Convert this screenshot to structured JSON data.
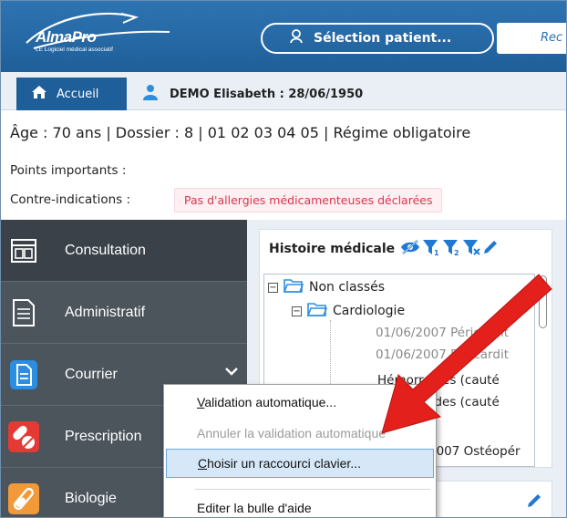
{
  "header": {
    "logo_text": "AlmaPro",
    "logo_subtitle": "LE Logiciel médical associatif",
    "select_patient_label": "Sélection patient...",
    "search_placeholder": "Rec"
  },
  "tabs": {
    "home_label": "Accueil",
    "patient_label": "DEMO Elisabeth : 28/06/1950"
  },
  "patient": {
    "info_line": "Âge : 70 ans | Dossier : 8 | 01 02 03 04 05 | Régime obligatoire",
    "points_label": "Points importants :",
    "contre_label": "Contre-indications :",
    "allergy_badge": "Pas d'allergies médicamenteuses déclarées"
  },
  "nav": {
    "items": [
      {
        "label": "Consultation"
      },
      {
        "label": "Administratif"
      },
      {
        "label": "Courrier"
      },
      {
        "label": "Prescription"
      },
      {
        "label": "Biologie"
      }
    ]
  },
  "history": {
    "title": "Histoire médicale",
    "tree": {
      "root": "Non classés",
      "category": "Cardiologie",
      "leaf1": "01/06/2007 Péricardit",
      "leaf2": "01/06/2007 Péricardit",
      "leaf3": "Hémorroïdes (cauté",
      "leaf4": "Hémorroïdes (cauté",
      "leaf5": "2007 Ostéopér"
    }
  },
  "context_menu": {
    "item1_ul": "V",
    "item1_rest": "alidation automatique...",
    "item2": "Annuler la validation automatique",
    "item3_ul": "C",
    "item3_rest": "hoisir un raccourci clavier...",
    "item4": "Editer la bulle d'aide"
  },
  "colors": {
    "brand_blue": "#1f5f99",
    "nav_bg": "#4c545c",
    "alert_red": "#d8374f",
    "arrow_red": "#e3201b"
  }
}
